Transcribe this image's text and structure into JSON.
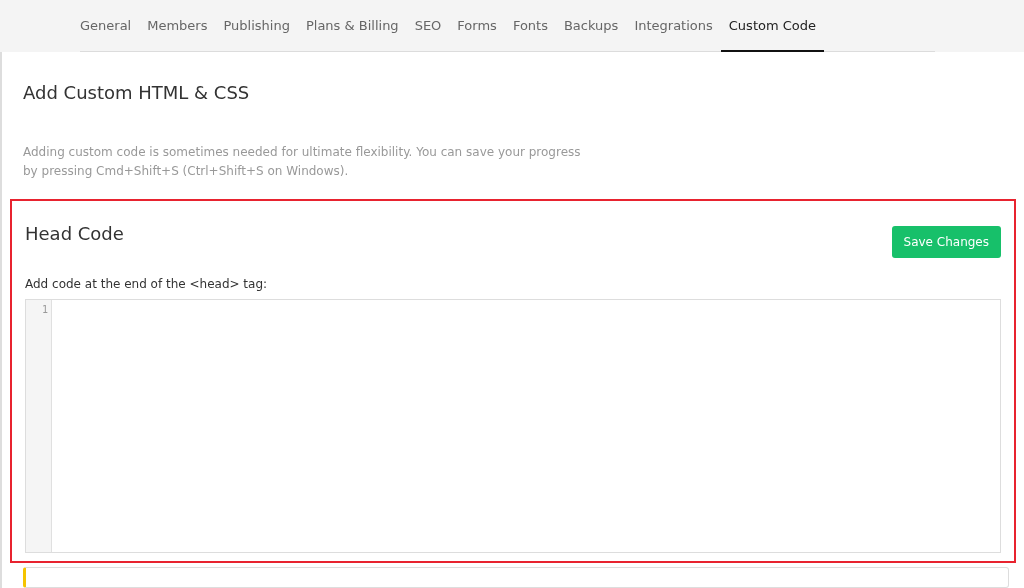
{
  "tabs": [
    {
      "label": "General",
      "selected": false
    },
    {
      "label": "Members",
      "selected": false
    },
    {
      "label": "Publishing",
      "selected": false
    },
    {
      "label": "Plans & Billing",
      "selected": false
    },
    {
      "label": "SEO",
      "selected": false
    },
    {
      "label": "Forms",
      "selected": false
    },
    {
      "label": "Fonts",
      "selected": false
    },
    {
      "label": "Backups",
      "selected": false
    },
    {
      "label": "Integrations",
      "selected": false
    },
    {
      "label": "Custom Code",
      "selected": true
    }
  ],
  "page": {
    "title": "Add Custom HTML & CSS",
    "description": "Adding custom code is sometimes needed for ultimate flexibility. You can save your progress by pressing Cmd+Shift+S (Ctrl+Shift+S on Windows)."
  },
  "head_code": {
    "title": "Head Code",
    "save_button": "Save Changes",
    "label": "Add code at the end of the <head> tag:",
    "editor": {
      "line_numbers": [
        "1"
      ]
    }
  }
}
